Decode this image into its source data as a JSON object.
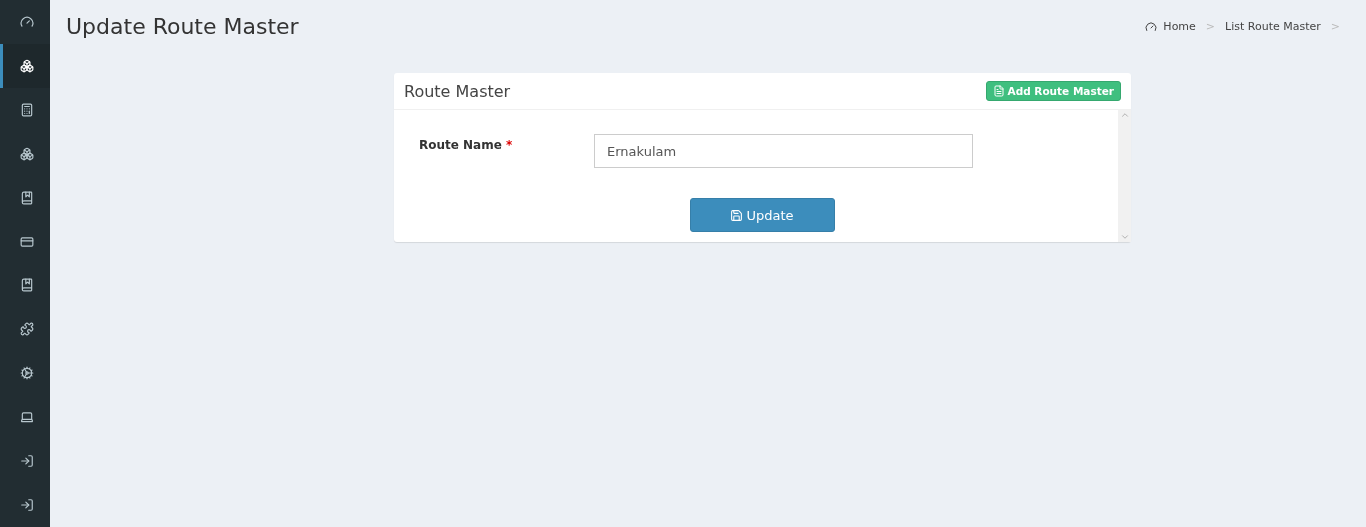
{
  "sidebar": {
    "items": [
      {
        "selected": false
      },
      {
        "selected": true
      },
      {
        "selected": false
      },
      {
        "selected": false
      },
      {
        "selected": false
      },
      {
        "selected": false
      },
      {
        "selected": false
      },
      {
        "selected": false
      },
      {
        "selected": false
      },
      {
        "selected": false
      },
      {
        "selected": false
      },
      {
        "selected": false
      }
    ]
  },
  "page_title": "Update Route Master",
  "breadcrumb": [
    {
      "label": "Home"
    },
    {
      "label": "List Route Master"
    }
  ],
  "breadcrumb_separator": ">",
  "card": {
    "title": "Route Master",
    "add_button": "Add Route Master",
    "fields": [
      {
        "label": "Route Name",
        "required_mark": "*",
        "value": "Ernakulam"
      }
    ],
    "submit_button": "Update"
  }
}
